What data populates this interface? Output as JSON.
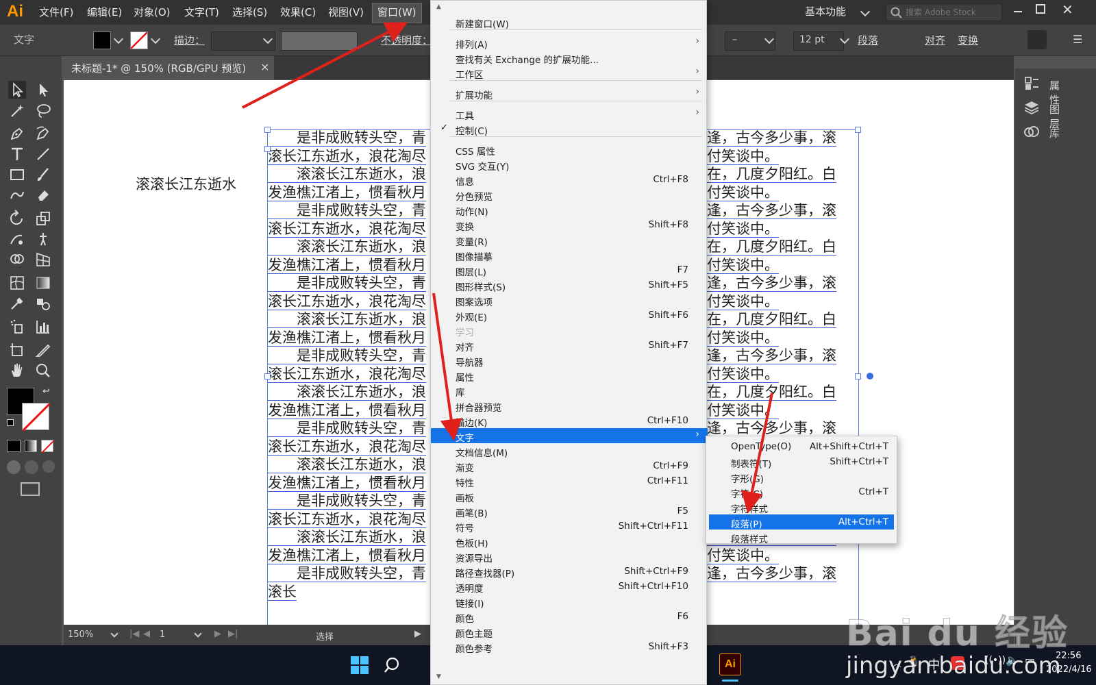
{
  "app": {
    "logo": "Ai",
    "workspace": "基本功能",
    "stock_search_placeholder": "搜索 Adobe Stock",
    "accent": "#1473e6"
  },
  "menubar": {
    "items": [
      "文件(F)",
      "编辑(E)",
      "对象(O)",
      "文字(T)",
      "选择(S)",
      "效果(C)",
      "视图(V)",
      "窗口(W)"
    ]
  },
  "controlbar": {
    "selection_label": "文字",
    "stroke_label": "描边：",
    "opacity_label": "不透明度：",
    "font_style": "–",
    "font_size": "12 pt",
    "paragraph_label": "段落",
    "align_label": "对齐",
    "transform_label": "变换"
  },
  "document": {
    "tab_title": "未标题-1* @ 150% (RGB/GPU 预览)",
    "zoom": "150%",
    "artboard": "1",
    "status_tool": "选择",
    "point_text": "滚滚长江东逝水",
    "lines": [
      "　　是非成败转头空，青",
      "滚长江东逝水，浪花淘尽",
      "　　滚滚长江东逝水，浪",
      "发渔樵江渚上，惯看秋月",
      "　　是非成败转头空，青",
      "滚长江东逝水，浪花淘尽",
      "　　滚滚长江东逝水，浪",
      "发渔樵江渚上，惯看秋月",
      "　　是非成败转头空，青",
      "滚长江东逝水，浪花淘尽",
      "　　滚滚长江东逝水，浪",
      "发渔樵江渚上，惯看秋月",
      "　　是非成败转头空，青",
      "滚长江东逝水，浪花淘尽",
      "　　滚滚长江东逝水，浪",
      "发渔樵江渚上，惯看秋月",
      "　　是非成败转头空，青",
      "滚长江东逝水，浪花淘尽",
      "　　滚滚长江东逝水，浪",
      "发渔樵江渚上，惯看秋月",
      "　　是非成败转头空，青",
      "滚长江东逝水，浪花淘尽",
      "　　滚滚长江东逝水，浪",
      "发渔樵江渚上，惯看秋月",
      "　　是非成败转头空，青",
      "滚长"
    ],
    "lines_right": [
      "相逢，古今多少事，滚",
      "都付笑谈中。",
      "阳在，几度夕阳红。白",
      "都付笑谈中。",
      "相逢，古今多少事，滚",
      "都付笑谈中。",
      "阳在，几度夕阳红。白",
      "都付笑谈中。",
      "相逢，古今多少事，滚",
      "都付笑谈中。",
      "阳在，几度夕阳红。白",
      "都付笑谈中。",
      "相逢，古今多少事，滚",
      "都付笑谈中。",
      "阳在，几度夕阳红。白",
      "都付笑谈中。",
      "相逢，古今多少事，滚",
      "都付笑谈中。",
      "阳在，几度夕阳红。白",
      "都付笑谈中。",
      "相逢，古今多少事，滚",
      "都付笑谈中。",
      "阳在，几度夕阳红。白",
      "都付笑谈中。",
      "相逢，古今多少事，滚",
      ""
    ]
  },
  "right_panel": {
    "items": [
      "属性",
      "图层",
      "库"
    ]
  },
  "window_menu": {
    "items": [
      {
        "label": "新建窗口(W)",
        "shortcut": "",
        "submenu": false
      },
      {
        "label": "排列(A)",
        "shortcut": "",
        "submenu": true
      },
      {
        "label": "查找有关 Exchange 的扩展功能...",
        "shortcut": "",
        "submenu": false
      },
      {
        "label": "工作区",
        "shortcut": "",
        "submenu": true
      },
      {
        "label": "扩展功能",
        "shortcut": "",
        "submenu": true
      },
      {
        "label": "工具",
        "shortcut": "",
        "submenu": true
      },
      {
        "label": "控制(C)",
        "shortcut": "",
        "submenu": false,
        "checked": true
      },
      {
        "label": "CSS 属性",
        "shortcut": "",
        "submenu": false
      },
      {
        "label": "SVG 交互(Y)",
        "shortcut": "",
        "submenu": false
      },
      {
        "label": "信息",
        "shortcut": "Ctrl+F8",
        "submenu": false
      },
      {
        "label": "分色预览",
        "shortcut": "",
        "submenu": false
      },
      {
        "label": "动作(N)",
        "shortcut": "",
        "submenu": false
      },
      {
        "label": "变换",
        "shortcut": "Shift+F8",
        "submenu": false
      },
      {
        "label": "变量(R)",
        "shortcut": "",
        "submenu": false
      },
      {
        "label": "图像描摹",
        "shortcut": "",
        "submenu": false
      },
      {
        "label": "图层(L)",
        "shortcut": "F7",
        "submenu": false
      },
      {
        "label": "图形样式(S)",
        "shortcut": "Shift+F5",
        "submenu": false
      },
      {
        "label": "图案选项",
        "shortcut": "",
        "submenu": false
      },
      {
        "label": "外观(E)",
        "shortcut": "Shift+F6",
        "submenu": false
      },
      {
        "label": "学习",
        "shortcut": "",
        "submenu": false,
        "disabled": true
      },
      {
        "label": "对齐",
        "shortcut": "Shift+F7",
        "submenu": false
      },
      {
        "label": "导航器",
        "shortcut": "",
        "submenu": false
      },
      {
        "label": "属性",
        "shortcut": "",
        "submenu": false
      },
      {
        "label": "库",
        "shortcut": "",
        "submenu": false
      },
      {
        "label": "拼合器预览",
        "shortcut": "",
        "submenu": false
      },
      {
        "label": "描边(K)",
        "shortcut": "Ctrl+F10",
        "submenu": false
      },
      {
        "label": "文字",
        "shortcut": "",
        "submenu": true,
        "highlighted": true
      },
      {
        "label": "文档信息(M)",
        "shortcut": "",
        "submenu": false
      },
      {
        "label": "渐变",
        "shortcut": "Ctrl+F9",
        "submenu": false
      },
      {
        "label": "特性",
        "shortcut": "Ctrl+F11",
        "submenu": false
      },
      {
        "label": "画板",
        "shortcut": "",
        "submenu": false
      },
      {
        "label": "画笔(B)",
        "shortcut": "F5",
        "submenu": false
      },
      {
        "label": "符号",
        "shortcut": "Shift+Ctrl+F11",
        "submenu": false
      },
      {
        "label": "色板(H)",
        "shortcut": "",
        "submenu": false
      },
      {
        "label": "资源导出",
        "shortcut": "",
        "submenu": false
      },
      {
        "label": "路径查找器(P)",
        "shortcut": "Shift+Ctrl+F9",
        "submenu": false
      },
      {
        "label": "透明度",
        "shortcut": "Shift+Ctrl+F10",
        "submenu": false
      },
      {
        "label": "链接(I)",
        "shortcut": "",
        "submenu": false
      },
      {
        "label": "颜色",
        "shortcut": "F6",
        "submenu": false
      },
      {
        "label": "颜色主题",
        "shortcut": "",
        "submenu": false
      },
      {
        "label": "颜色参考",
        "shortcut": "Shift+F3",
        "submenu": false
      }
    ]
  },
  "type_submenu": {
    "items": [
      {
        "label": "OpenType(O)",
        "shortcut": "Alt+Shift+Ctrl+T"
      },
      {
        "label": "制表符(T)",
        "shortcut": "Shift+Ctrl+T"
      },
      {
        "label": "字形(G)",
        "shortcut": ""
      },
      {
        "label": "字符(C)",
        "shortcut": "Ctrl+T"
      },
      {
        "label": "字符样式",
        "shortcut": ""
      },
      {
        "label": "段落(P)",
        "shortcut": "Alt+Ctrl+T",
        "highlighted": true
      },
      {
        "label": "段落样式",
        "shortcut": ""
      }
    ]
  },
  "taskbar": {
    "ime": "中",
    "time": "22:56",
    "date": "2022/4/16",
    "app_icon_label": "Ai"
  },
  "watermark": {
    "text": "Bai du 经验",
    "url": "jingyan.baidu.com"
  }
}
